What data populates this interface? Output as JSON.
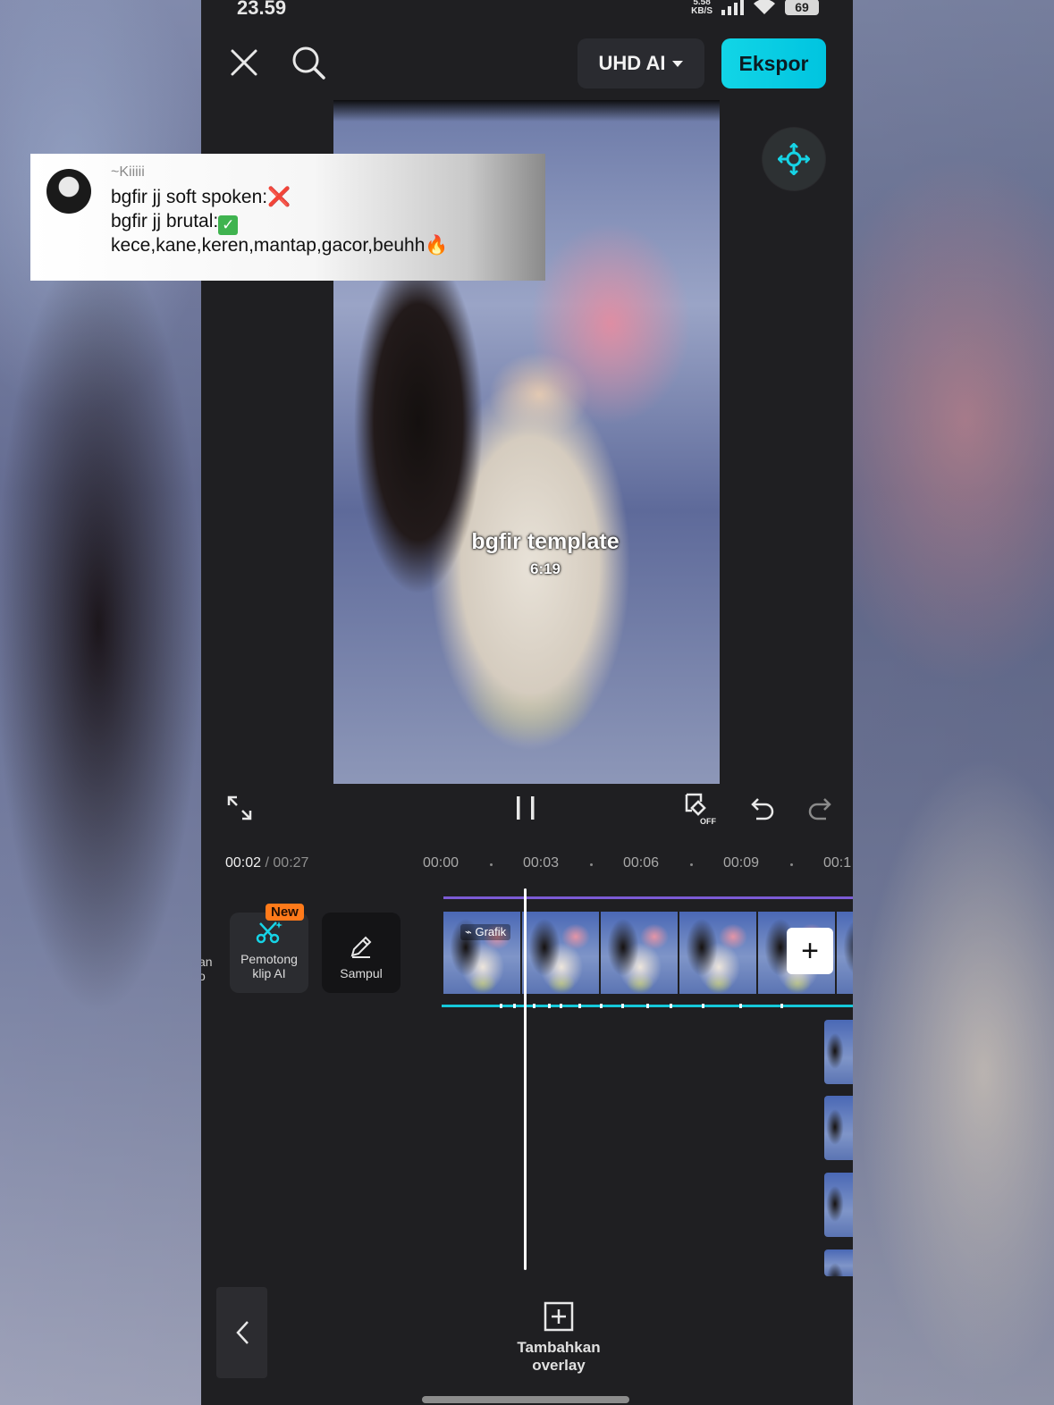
{
  "status_bar": {
    "time": "23.59",
    "net_speed_value": "5.58",
    "net_speed_unit": "KB/S",
    "battery": "69"
  },
  "top_bar": {
    "quality_label": "UHD AI",
    "export_label": "Ekspor"
  },
  "comment_overlay": {
    "username": "~Kiiiii",
    "line1": "bgfir jj soft spoken:",
    "line1_emoji": "❌",
    "line2": "bgfir jj brutal:",
    "line2_emoji": "✓",
    "line3": "kece,kane,keren,mantap,gacor,beuhh",
    "line3_emoji": "🔥"
  },
  "preview": {
    "watermark_title": "bgfir template",
    "watermark_subtitle": "6:19"
  },
  "playback": {
    "current_time": "00:02",
    "total_time": "/ 00:27",
    "ruler_marks": [
      "00:00",
      "00:03",
      "00:06",
      "00:09",
      "00:1"
    ]
  },
  "tools": {
    "partial_left_label_1": "an",
    "partial_left_label_2": "o",
    "ai_cutter_badge": "New",
    "ai_cutter_label_1": "Pemotong",
    "ai_cutter_label_2": "klip AI",
    "cover_label": "Sampul"
  },
  "timeline": {
    "clip_tag": "Grafik",
    "add_clip_symbol": "+"
  },
  "bottom": {
    "add_overlay_label_1": "Tambahkan",
    "add_overlay_label_2": "overlay"
  },
  "colors": {
    "accent": "#12d5e6",
    "badge": "#ff7a1a",
    "track_purple": "#7c5bd6",
    "track_cyan": "#16c9da"
  },
  "icons": {
    "close": "close-icon",
    "search": "search-icon",
    "ai_feature": "ai-move-icon",
    "fullscreen": "fullscreen-icon",
    "pause": "pause-icon",
    "keyframe": "keyframe-off-icon",
    "undo": "undo-icon",
    "redo": "redo-icon",
    "cutter": "scissors-ai-icon",
    "cover": "pencil-icon",
    "add_overlay": "plus-square-icon",
    "back": "chevron-left-icon"
  }
}
